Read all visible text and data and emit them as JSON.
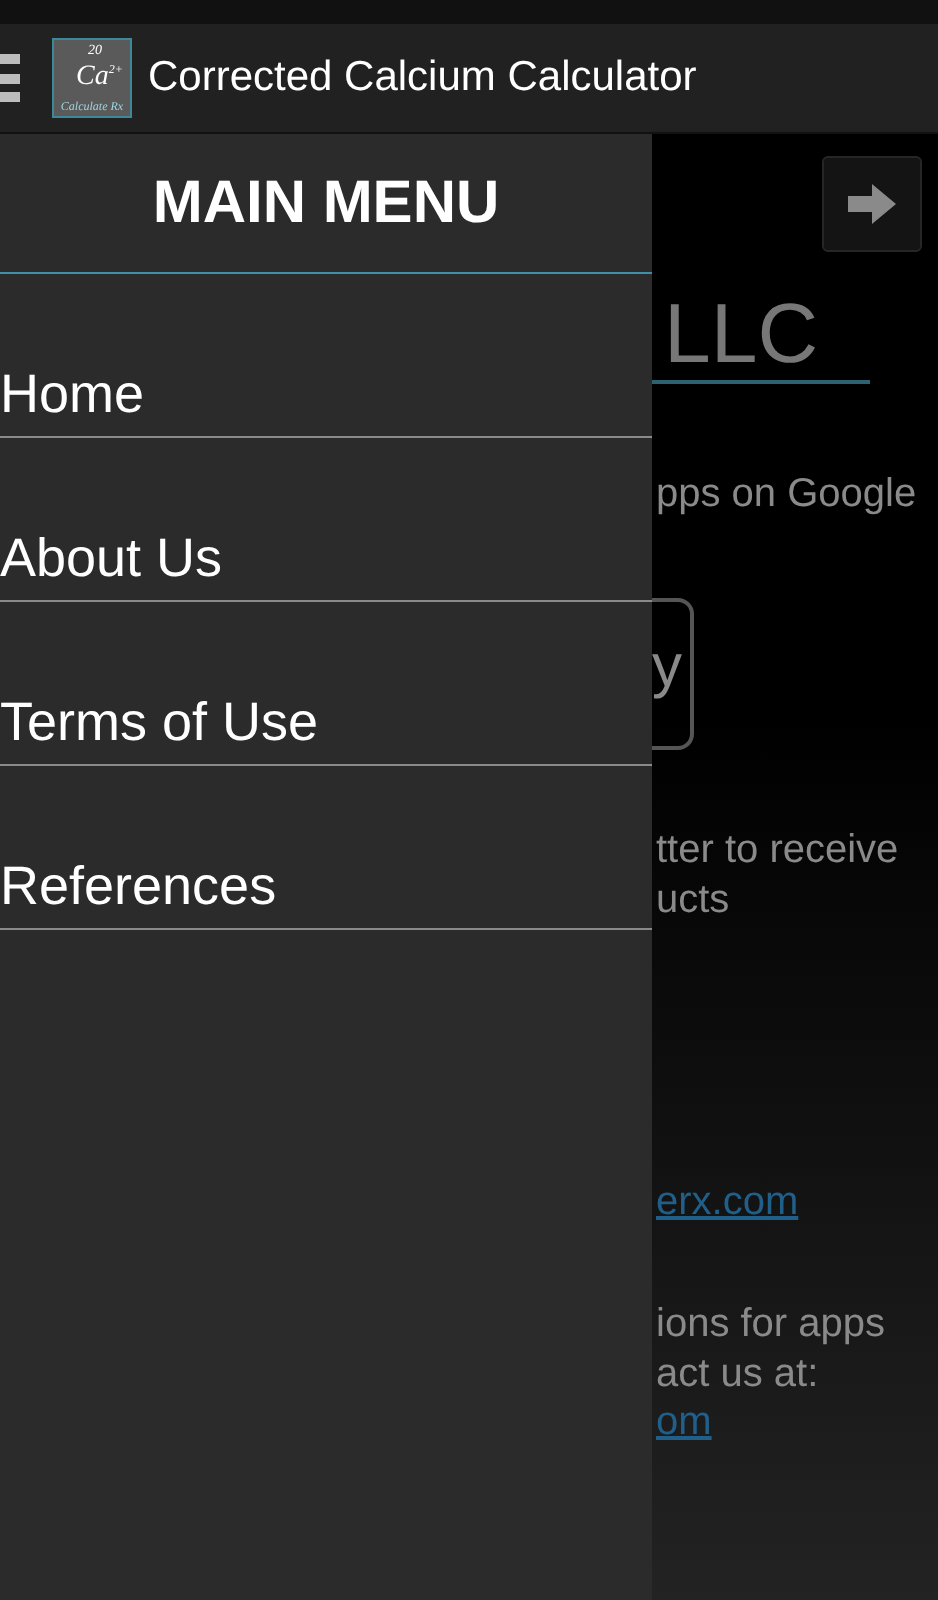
{
  "action_bar": {
    "title": "Corrected Calcium Calculator",
    "app_icon": {
      "number": "20",
      "symbol": "Ca",
      "charge": "2+",
      "caption": "Calculate Rx"
    }
  },
  "drawer": {
    "title": "MAIN MENU",
    "items": [
      {
        "label": "Home"
      },
      {
        "label": "About Us"
      },
      {
        "label": "Terms of Use"
      },
      {
        "label": "References"
      }
    ]
  },
  "content": {
    "heading": "LLC",
    "paragraph_1": "pps on Google",
    "button": "y",
    "paragraph_2": [
      "tter to receive",
      "ucts"
    ],
    "link_1": "erx.com",
    "paragraph_3": [
      "ions for apps",
      "act us at:"
    ],
    "link_2": "om"
  }
}
